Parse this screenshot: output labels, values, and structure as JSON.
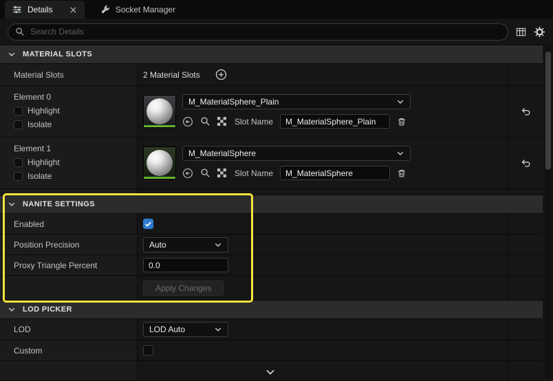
{
  "colors": {
    "highlight_outline": "#F5E53C",
    "checkbox_checked": "#2E7BD2",
    "asset_green": "#63B32E"
  },
  "tabbar": {
    "tabs": [
      {
        "label": "Details"
      },
      {
        "label": "Socket Manager"
      }
    ]
  },
  "search": {
    "placeholder": "Search Details"
  },
  "material_slots": {
    "title": "MATERIAL SLOTS",
    "count_label": "Material Slots",
    "count_value": "2 Material Slots",
    "elements": [
      {
        "name": "Element 0",
        "highlight_label": "Highlight",
        "isolate_label": "Isolate",
        "material": "M_MaterialSphere_Plain",
        "slot_name_label": "Slot Name",
        "slot_name": "M_MaterialSphere_Plain"
      },
      {
        "name": "Element 1",
        "highlight_label": "Highlight",
        "isolate_label": "Isolate",
        "material": "M_MaterialSphere",
        "slot_name_label": "Slot Name",
        "slot_name": "M_MaterialSphere"
      }
    ]
  },
  "nanite": {
    "title": "NANITE SETTINGS",
    "enabled_label": "Enabled",
    "position_precision_label": "Position Precision",
    "position_precision_value": "Auto",
    "proxy_triangle_label": "Proxy Triangle Percent",
    "proxy_triangle_value": "0.0",
    "apply_label": "Apply Changes"
  },
  "lod": {
    "title": "LOD PICKER",
    "lod_label": "LOD",
    "lod_value": "LOD Auto",
    "custom_label": "Custom"
  },
  "icons": {
    "details_tab": "sliders",
    "tab_close": "x",
    "socket_manager_tab": "wrench",
    "search": "magnifier",
    "view_options": "table-grid",
    "settings": "gear",
    "section_chevron": "chevron-down",
    "add_slot": "circle-plus",
    "use_selected": "circle-arrow-left",
    "browse": "magnifier",
    "pick_asset": "checkerboard",
    "delete_slot": "trash",
    "reset_default": "undo-arrow",
    "combo_chevron": "chevron-down",
    "checkbox_check": "check",
    "scroll_more": "chevron-down"
  }
}
